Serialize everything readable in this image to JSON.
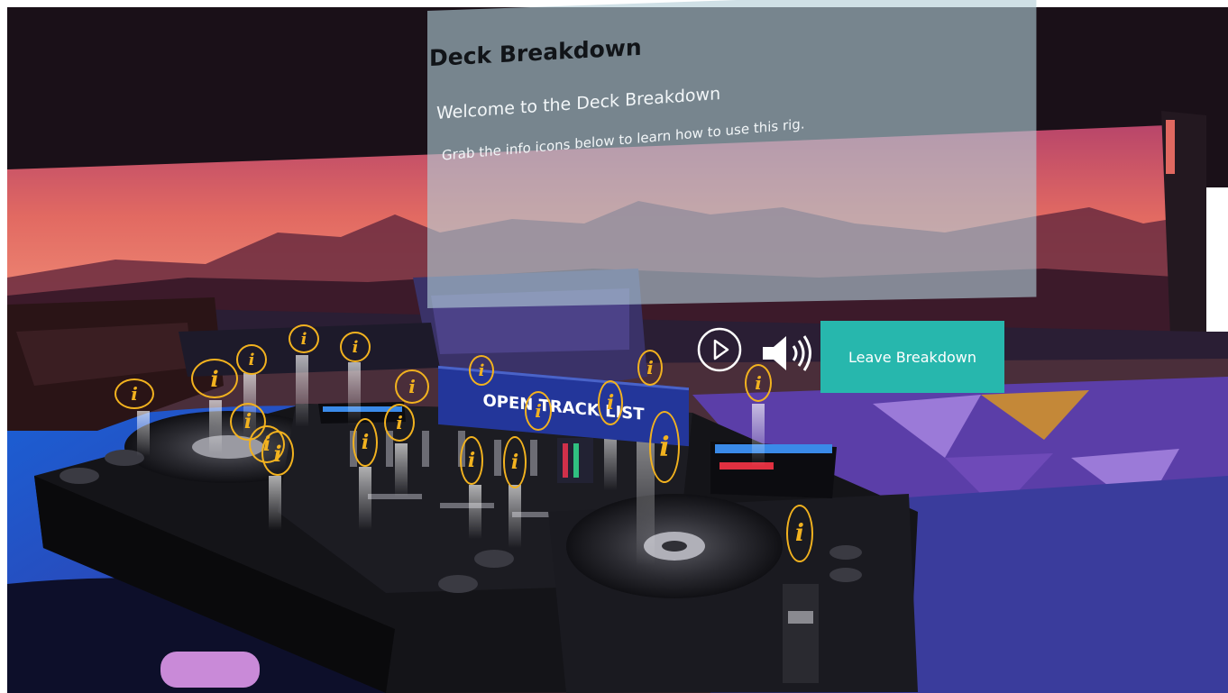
{
  "panel": {
    "title": "Deck Breakdown",
    "welcome": "Welcome to the Deck Breakdown",
    "instruction": "Grab the info icons below to learn how to use this rig."
  },
  "controls": {
    "play_icon": "play-icon",
    "speaker_icon": "speaker-icon",
    "leave_label": "Leave Breakdown"
  },
  "track_list": {
    "label": "OPEN TRACK LIST"
  },
  "info_glyph": "i",
  "colors": {
    "info_ring": "#f2b21f",
    "leave_button": "#27b7ad",
    "track_list_button": "#23369a",
    "sky_top": "#c9555e",
    "floor_blue": "#2b7fe0"
  }
}
